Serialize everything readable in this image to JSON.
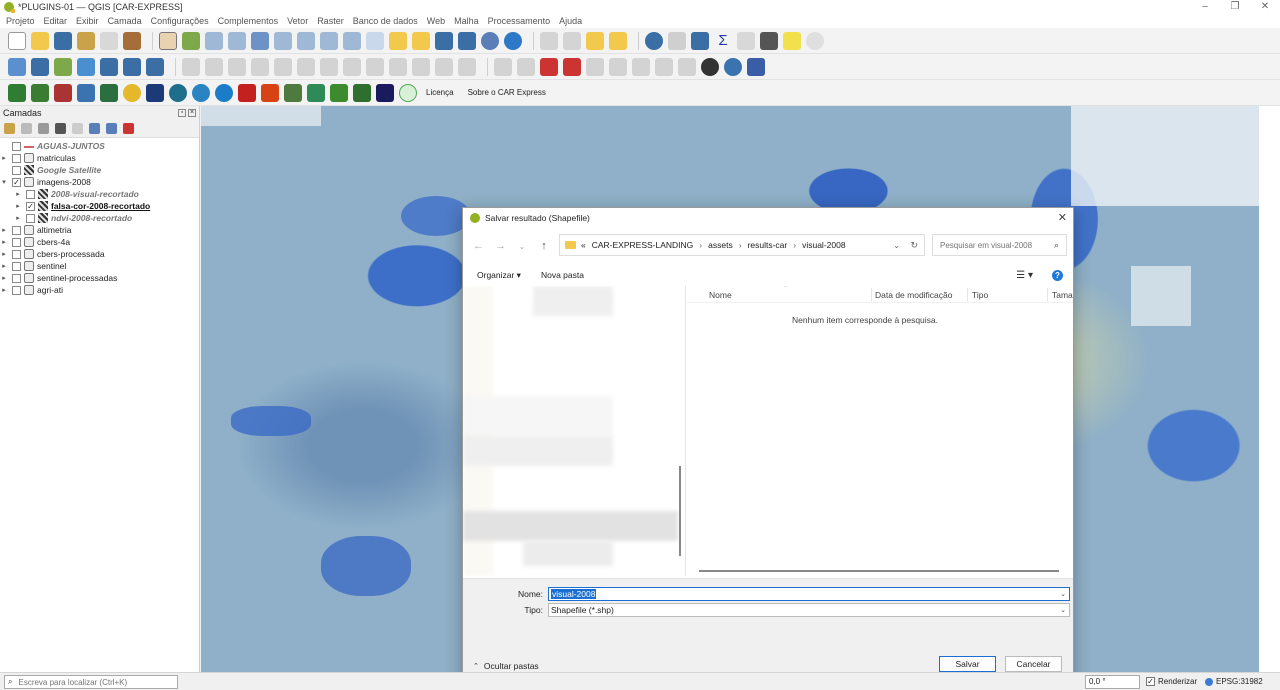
{
  "window": {
    "title": "*PLUGINS-01 — QGIS [CAR-EXPRESS]"
  },
  "menu": [
    "Projeto",
    "Editar",
    "Exibir",
    "Camada",
    "Configurações",
    "Complementos",
    "Vetor",
    "Raster",
    "Banco de dados",
    "Web",
    "Malha",
    "Processamento",
    "Ajuda"
  ],
  "toolbar3": {
    "licenca": "Licença",
    "sobre": "Sobre o CAR Express"
  },
  "layers_panel": {
    "title": "Camadas",
    "layers": [
      {
        "name": "AGUAS-JUNTOS",
        "style": "italic",
        "checked": false,
        "expand": "",
        "icon": "line-icon"
      },
      {
        "name": "matriculas",
        "style": "normal",
        "checked": false,
        "expand": "▸",
        "icon": "group-icon"
      },
      {
        "name": "Google Satellite",
        "style": "italic",
        "checked": false,
        "expand": "",
        "icon": "raster-icon"
      },
      {
        "name": "imagens-2008",
        "style": "normal",
        "checked": true,
        "expand": "▾",
        "icon": "group-icon"
      },
      {
        "name": "2008-visual-recortado",
        "style": "italic",
        "checked": false,
        "expand": "▸",
        "icon": "raster-icon",
        "indent": true
      },
      {
        "name": "falsa-cor-2008-recortado",
        "style": "bold",
        "checked": true,
        "expand": "▸",
        "icon": "raster-icon",
        "indent": true
      },
      {
        "name": "ndvi-2008-recortado",
        "style": "italic",
        "checked": false,
        "expand": "▸",
        "icon": "raster-icon",
        "indent": true
      },
      {
        "name": "altimetria",
        "style": "normal",
        "checked": false,
        "expand": "▸",
        "icon": "group-icon"
      },
      {
        "name": "cbers-4a",
        "style": "normal",
        "checked": false,
        "expand": "▸",
        "icon": "group-icon"
      },
      {
        "name": "cbers-processada",
        "style": "normal",
        "checked": false,
        "expand": "▸",
        "icon": "group-icon"
      },
      {
        "name": "sentinel",
        "style": "normal",
        "checked": false,
        "expand": "▸",
        "icon": "group-icon"
      },
      {
        "name": "sentinel-processadas",
        "style": "normal",
        "checked": false,
        "expand": "▸",
        "icon": "group-icon"
      },
      {
        "name": "agri-ati",
        "style": "normal",
        "checked": false,
        "expand": "▸",
        "icon": "group-icon"
      }
    ]
  },
  "dialog": {
    "title": "Salvar resultado (Shapefile)",
    "path": [
      "CAR-EXPRESS-LANDING",
      "assets",
      "results-car",
      "visual-2008"
    ],
    "path_prefix": "«",
    "search_placeholder": "Pesquisar em visual-2008",
    "organize": "Organizar ▾",
    "new_folder": "Nova pasta",
    "columns": [
      "Nome",
      "Data de modificação",
      "Tipo",
      "Taman"
    ],
    "empty_message": "Nenhum item corresponde à pesquisa.",
    "name_label": "Nome:",
    "name_value": "visual-2008",
    "type_label": "Tipo:",
    "type_value": "Shapefile (*.shp)",
    "hide_folders": "Ocultar pastas",
    "save": "Salvar",
    "cancel": "Cancelar"
  },
  "statusbar": {
    "locator_placeholder": "Escreva para localizar (Ctrl+K)",
    "rotation": "0,0 °",
    "render": "Renderizar",
    "epsg": "EPSG:31982"
  }
}
